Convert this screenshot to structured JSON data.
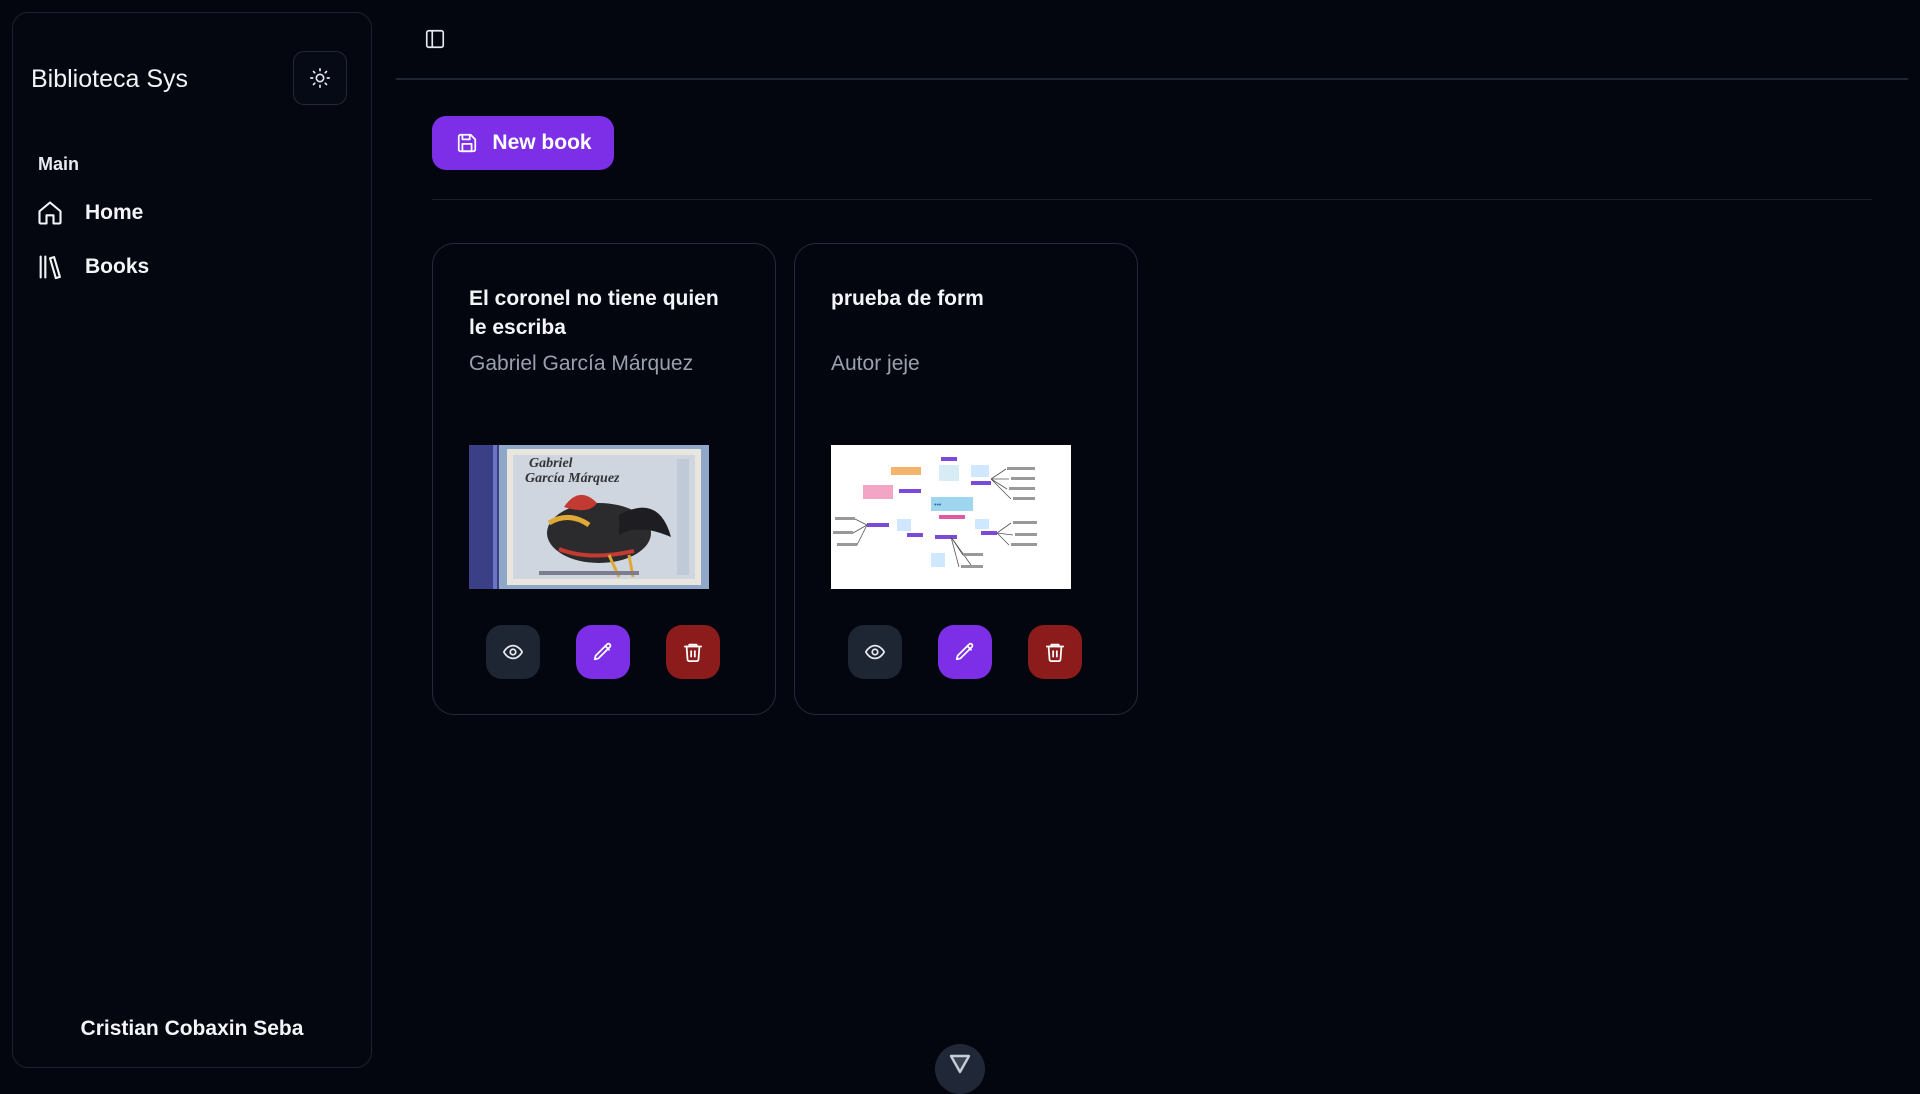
{
  "app": {
    "brand": "Biblioteca Sys",
    "theme_toggle_icon": "sun-icon"
  },
  "sidebar": {
    "section_label": "Main",
    "items": [
      {
        "label": "Home",
        "icon": "home-icon"
      },
      {
        "label": "Books",
        "icon": "library-icon"
      }
    ],
    "user_name": "Cristian Cobaxin Seba"
  },
  "toolbar": {
    "sidebar_toggle_icon": "panel-left-icon",
    "new_book_label": "New book",
    "new_book_icon": "save-icon"
  },
  "books": [
    {
      "title": "El coronel no tiene quien le escriba",
      "author": "Gabriel García Márquez",
      "cover": "book cover with rooster illustration",
      "cover_text": "Gabriel García Márquez"
    },
    {
      "title": "prueba de form",
      "author": "Autor jeje",
      "cover": "mind map diagram"
    }
  ],
  "card_actions": {
    "view_icon": "eye-icon",
    "edit_icon": "pencil-icon",
    "delete_icon": "trash-icon"
  },
  "colors": {
    "background": "#03060f",
    "accent": "#7c2fe6",
    "danger": "#8c1b1b",
    "muted_button": "#1f2633"
  }
}
